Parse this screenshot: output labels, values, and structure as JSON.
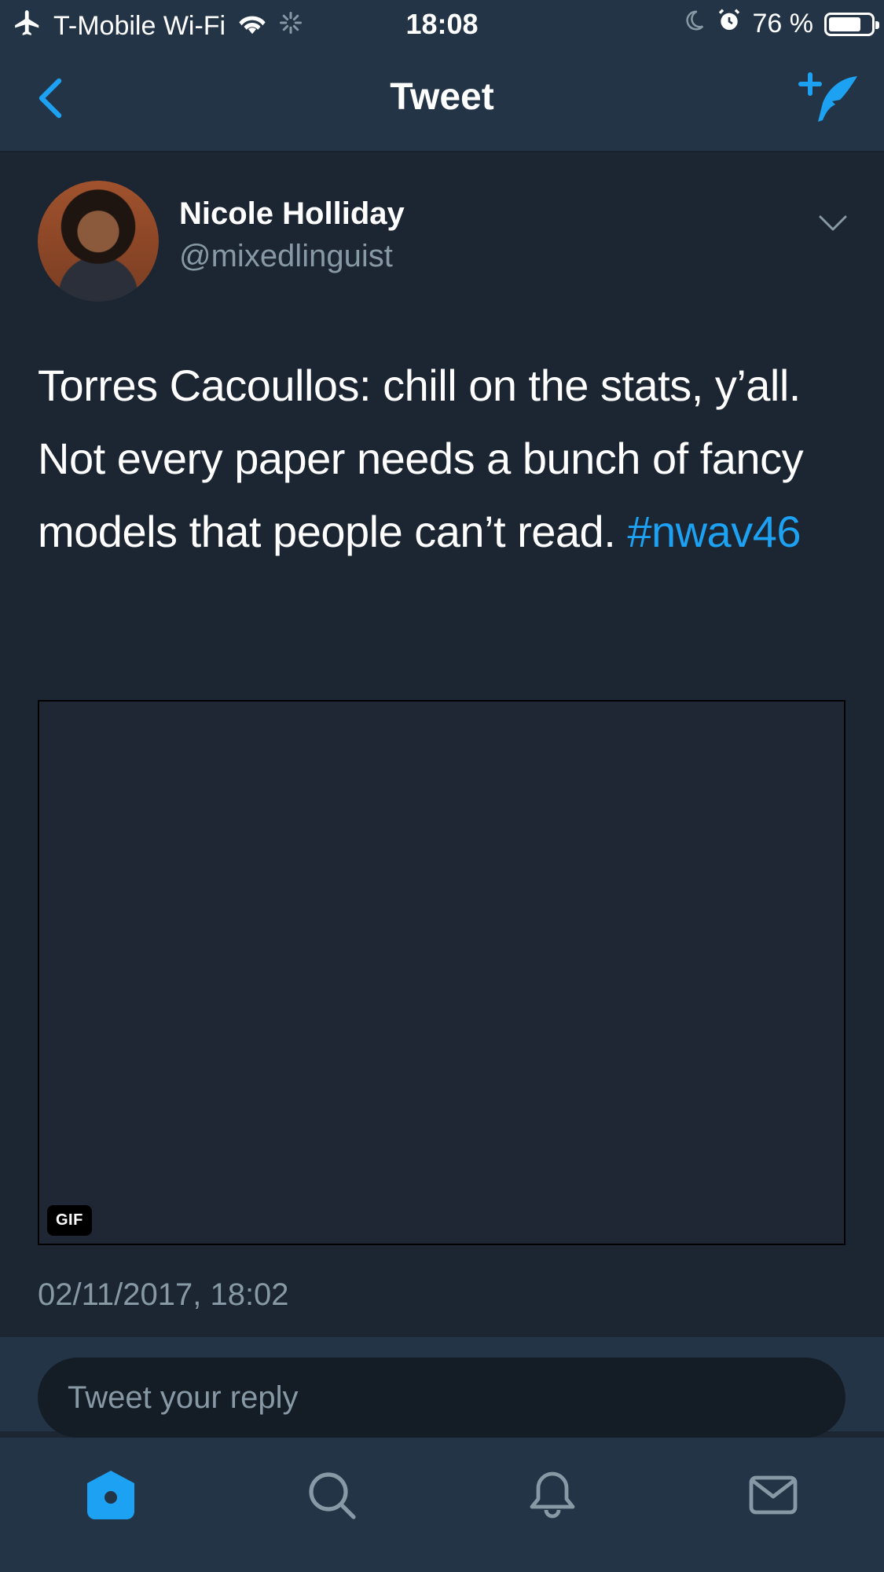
{
  "status_bar": {
    "carrier": "T-Mobile Wi-Fi",
    "time": "18:08",
    "battery_percent": "76 %",
    "battery_level": 0.76
  },
  "nav": {
    "title": "Tweet"
  },
  "tweet": {
    "display_name": "Nicole Holliday",
    "handle": "@mixedlinguist",
    "text": "Torres Cacoullos: chill on the stats, y’all. Not every paper needs a bunch of fancy models that people can’t read. ",
    "hashtag": "#nwav46",
    "media_badge": "GIF",
    "timestamp": "02/11/2017, 18:02"
  },
  "reply": {
    "placeholder": "Tweet your reply"
  },
  "tabs": {
    "items": [
      {
        "icon": "home-icon",
        "active": true
      },
      {
        "icon": "search-icon",
        "active": false
      },
      {
        "icon": "notifications-icon",
        "active": false
      },
      {
        "icon": "messages-icon",
        "active": false
      }
    ]
  },
  "colors": {
    "background": "#1c2532",
    "bar": "#243447",
    "accent": "#1da1f2",
    "muted": "#8899a6"
  }
}
